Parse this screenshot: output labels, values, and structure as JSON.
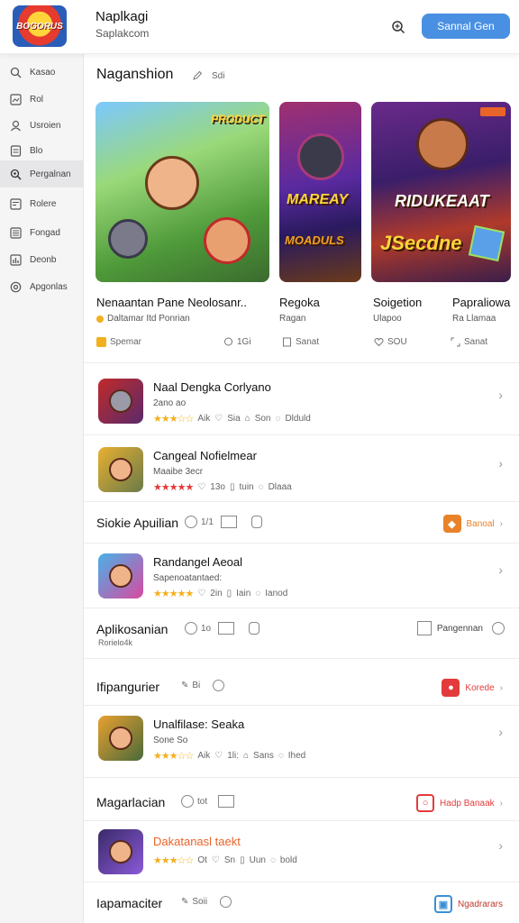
{
  "header": {
    "logo_text": "BOGORUS",
    "title": "Naplkagi",
    "subtitle": "Saplakcom",
    "button_label": "Sannal Gen"
  },
  "sidebar": {
    "items": [
      {
        "label": "Kasao",
        "icon": "search-icon"
      },
      {
        "label": "Rol",
        "icon": "image-icon"
      },
      {
        "label": "Usroien",
        "icon": "user-icon"
      },
      {
        "label": "Blo",
        "icon": "document-icon"
      },
      {
        "label": "Pergalnan",
        "icon": "search-gear-icon",
        "active": true
      },
      {
        "label": "Rolere",
        "icon": "grid-icon"
      },
      {
        "label": "Fongad",
        "icon": "list-icon"
      },
      {
        "label": "Deonb",
        "icon": "chart-icon"
      },
      {
        "label": "Apgonlas",
        "icon": "settings-icon"
      }
    ]
  },
  "featured": {
    "title": "Naganshion",
    "count_label": "Sdi",
    "tiles": [
      {
        "art_text": "PRODUCT",
        "title": "Nenaantan Pane Neolosanr..",
        "subtitle": "Daltamar Itd Ponrian",
        "meta1": "Spemar",
        "meta2": "1Gi",
        "accent": "#f2b01e"
      },
      {
        "art_text": "MAREAY",
        "art_text2": "MOADULS",
        "title": "Regoka",
        "subtitle": "Ragan",
        "meta": "Sanat"
      },
      {
        "art_text": "RIDUKEAAT",
        "art_text2": "JSecdne",
        "title": "Soigetion",
        "subtitle": "Ulapoo",
        "meta": "SOU"
      },
      {
        "title": "Papraliowa",
        "subtitle": "Ra Llamaa",
        "meta": "Sanat"
      }
    ]
  },
  "list1": [
    {
      "name": "Naal Dengka Corlyano",
      "sub": "2ano ao",
      "stars": "★★★☆☆",
      "star_color": "gold",
      "m1": "Aik",
      "m2": "Sia",
      "m3": "Son",
      "m4": "Dlduld"
    },
    {
      "name": "Cangeal Nofielmear",
      "sub": "Maaibe 3ecr",
      "stars": "★★★★★",
      "star_color": "red",
      "m1": "13o",
      "m2": "tuin",
      "m3": "Dlaaa"
    }
  ],
  "section_b": {
    "title": "Siokie Apuilian",
    "m1": "1/1",
    "m2": "",
    "action": "Banoal",
    "action_color": "#e8832a"
  },
  "list2": [
    {
      "name": "Randangel Aeoal",
      "sub": "Sapenoatantaed:",
      "stars": "★★★★★",
      "star_color": "gold",
      "m1": "2in",
      "m2": "Iain",
      "m3": "Ianod"
    }
  ],
  "section_c": {
    "title": "Aplikosanian",
    "sub": "Rorielo4k",
    "m1": "1o",
    "action": "Pangennan"
  },
  "section_d": {
    "title": "Ifipangurier",
    "m1": "Bi",
    "action": "Korede",
    "action_color": "#e33b3b"
  },
  "list3": [
    {
      "name": "Unalfilase: Seaka",
      "sub": "Sone So",
      "stars": "★★★☆☆",
      "star_color": "gold",
      "m1": "Aik",
      "m2": "1li:",
      "m3": "Sans",
      "m4": "Ihed"
    }
  ],
  "section_e": {
    "title": "Magarlacian",
    "m1": "tot",
    "action": "Hadp Banaak",
    "action_color": "#e33b3b"
  },
  "list4": [
    {
      "name": "Dakatanasl taekt",
      "sub": "",
      "stars": "★★★☆☆",
      "star_color": "gold",
      "m1": "Ot",
      "m2": "Sn",
      "m3": "Uun",
      "m4": "bold",
      "name_color": "#e8642a"
    }
  ],
  "section_f": {
    "title": "Iapamaciter",
    "m1": "Soii",
    "action": "Ngadrarars",
    "action_color": "#3a8fd4"
  }
}
